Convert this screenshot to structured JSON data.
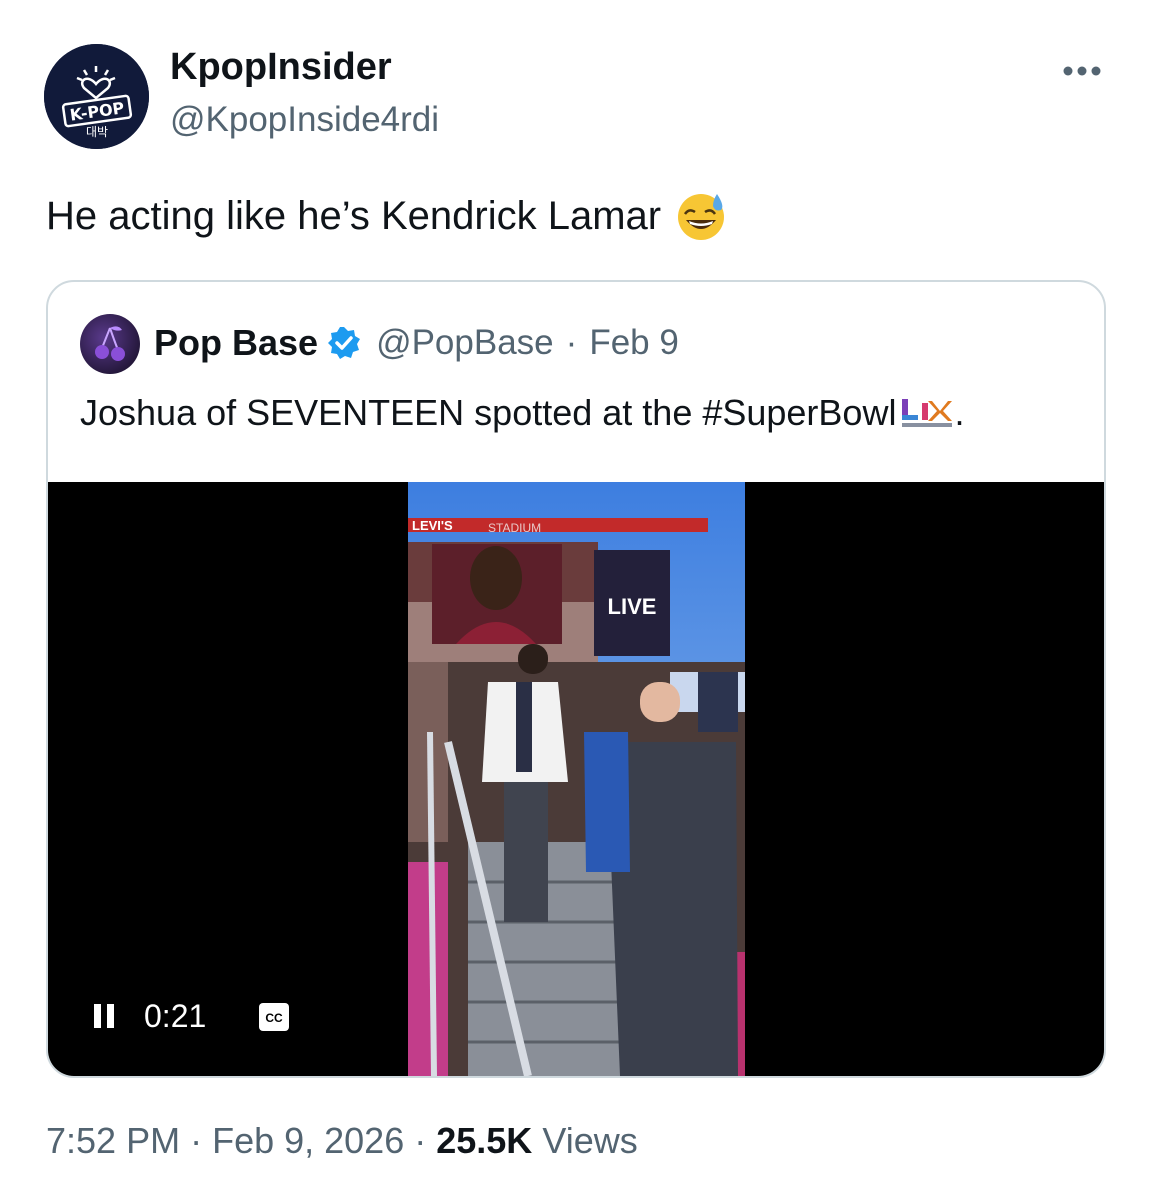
{
  "author": {
    "display_name": "KpopInsider",
    "handle": "@KpopInside4rdi",
    "avatar_logo_text": "K-POP",
    "avatar_logo_subtext": "대박"
  },
  "tweet": {
    "text": "He acting like he’s Kendrick Lamar",
    "emoji": "grinning-face-with-sweat-icon"
  },
  "quoted_tweet": {
    "display_name": "Pop Base",
    "verified": true,
    "handle": "@PopBase",
    "separator": "·",
    "date": "Feb 9",
    "text": "Joshua of SEVENTEEN spotted at the #SuperBowl",
    "trailing_punct": ".",
    "video": {
      "elapsed": "0:21",
      "state": "playing",
      "captions_label": "CC",
      "scene_text": {
        "sponsor": "LEVI'S",
        "stadium": "STADIUM",
        "screen": "LIVE"
      }
    }
  },
  "meta": {
    "time": "7:52 PM",
    "date": "Feb 9, 2026",
    "separator": "·",
    "views_count": "25.5K",
    "views_label": "Views"
  },
  "colors": {
    "text_primary": "#0f1419",
    "text_secondary": "#536471",
    "border": "#cfd9de",
    "verified_blue": "#1d9bf0"
  }
}
